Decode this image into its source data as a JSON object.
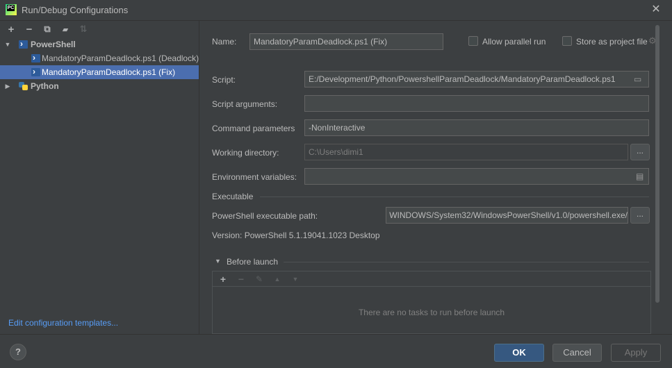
{
  "window": {
    "title": "Run/Debug Configurations",
    "app_icon": "PC"
  },
  "left": {
    "toolbar": [
      {
        "icon": "add-icon",
        "glyph": "+",
        "enabled": true
      },
      {
        "icon": "remove-icon",
        "glyph": "−",
        "enabled": true
      },
      {
        "icon": "copy-icon",
        "glyph": "⧉",
        "enabled": true
      },
      {
        "icon": "folder-icon",
        "glyph": "▰",
        "enabled": true
      },
      {
        "icon": "sort-icon",
        "glyph": "⇅",
        "enabled": false
      }
    ],
    "tree": {
      "powershell_group": "PowerShell",
      "items": [
        "MandatoryParamDeadlock.ps1 (Deadlock)",
        "MandatoryParamDeadlock.ps1 (Fix)"
      ],
      "python_group": "Python"
    },
    "edit_templates_link": "Edit configuration templates..."
  },
  "form": {
    "name_label": "Name:",
    "name_value": "MandatoryParamDeadlock.ps1 (Fix)",
    "allow_parallel_label": "Allow parallel run",
    "store_as_project_label": "Store as project file",
    "script_label": "Script:",
    "script_value": "E:/Development/Python/PowershellParamDeadlock/MandatoryParamDeadlock.ps1",
    "script_args_label": "Script arguments:",
    "script_args_value": "",
    "command_params_label": "Command parameters",
    "command_params_value": "-NonInteractive",
    "working_dir_label": "Working directory:",
    "working_dir_placeholder": "C:\\Users\\dimi1",
    "env_vars_label": "Environment variables:",
    "env_vars_value": "",
    "executable_section": "Executable",
    "ps_exe_label": "PowerShell executable path:",
    "ps_exe_value": "/WINDOWS/System32/WindowsPowerShell/v1.0/powershell.exe",
    "browse_label": "...",
    "version_text": "Version: PowerShell 5.1.19041.1023 Desktop"
  },
  "before_launch": {
    "title": "Before launch",
    "toolbar": [
      {
        "icon": "add-icon",
        "glyph": "+",
        "enabled": true
      },
      {
        "icon": "remove-icon",
        "glyph": "−",
        "enabled": false
      },
      {
        "icon": "edit-icon",
        "glyph": "✎",
        "enabled": false
      },
      {
        "icon": "move-up-icon",
        "glyph": "▲",
        "enabled": false
      },
      {
        "icon": "move-down-icon",
        "glyph": "▼",
        "enabled": false
      }
    ],
    "empty_text": "There are no tasks to run before launch"
  },
  "buttons": {
    "help": "?",
    "ok": "OK",
    "cancel": "Cancel",
    "apply": "Apply"
  },
  "colors": {
    "background": "#3c3f41",
    "selection": "#4b6eaf",
    "link": "#589df6",
    "primary_button": "#365880"
  }
}
